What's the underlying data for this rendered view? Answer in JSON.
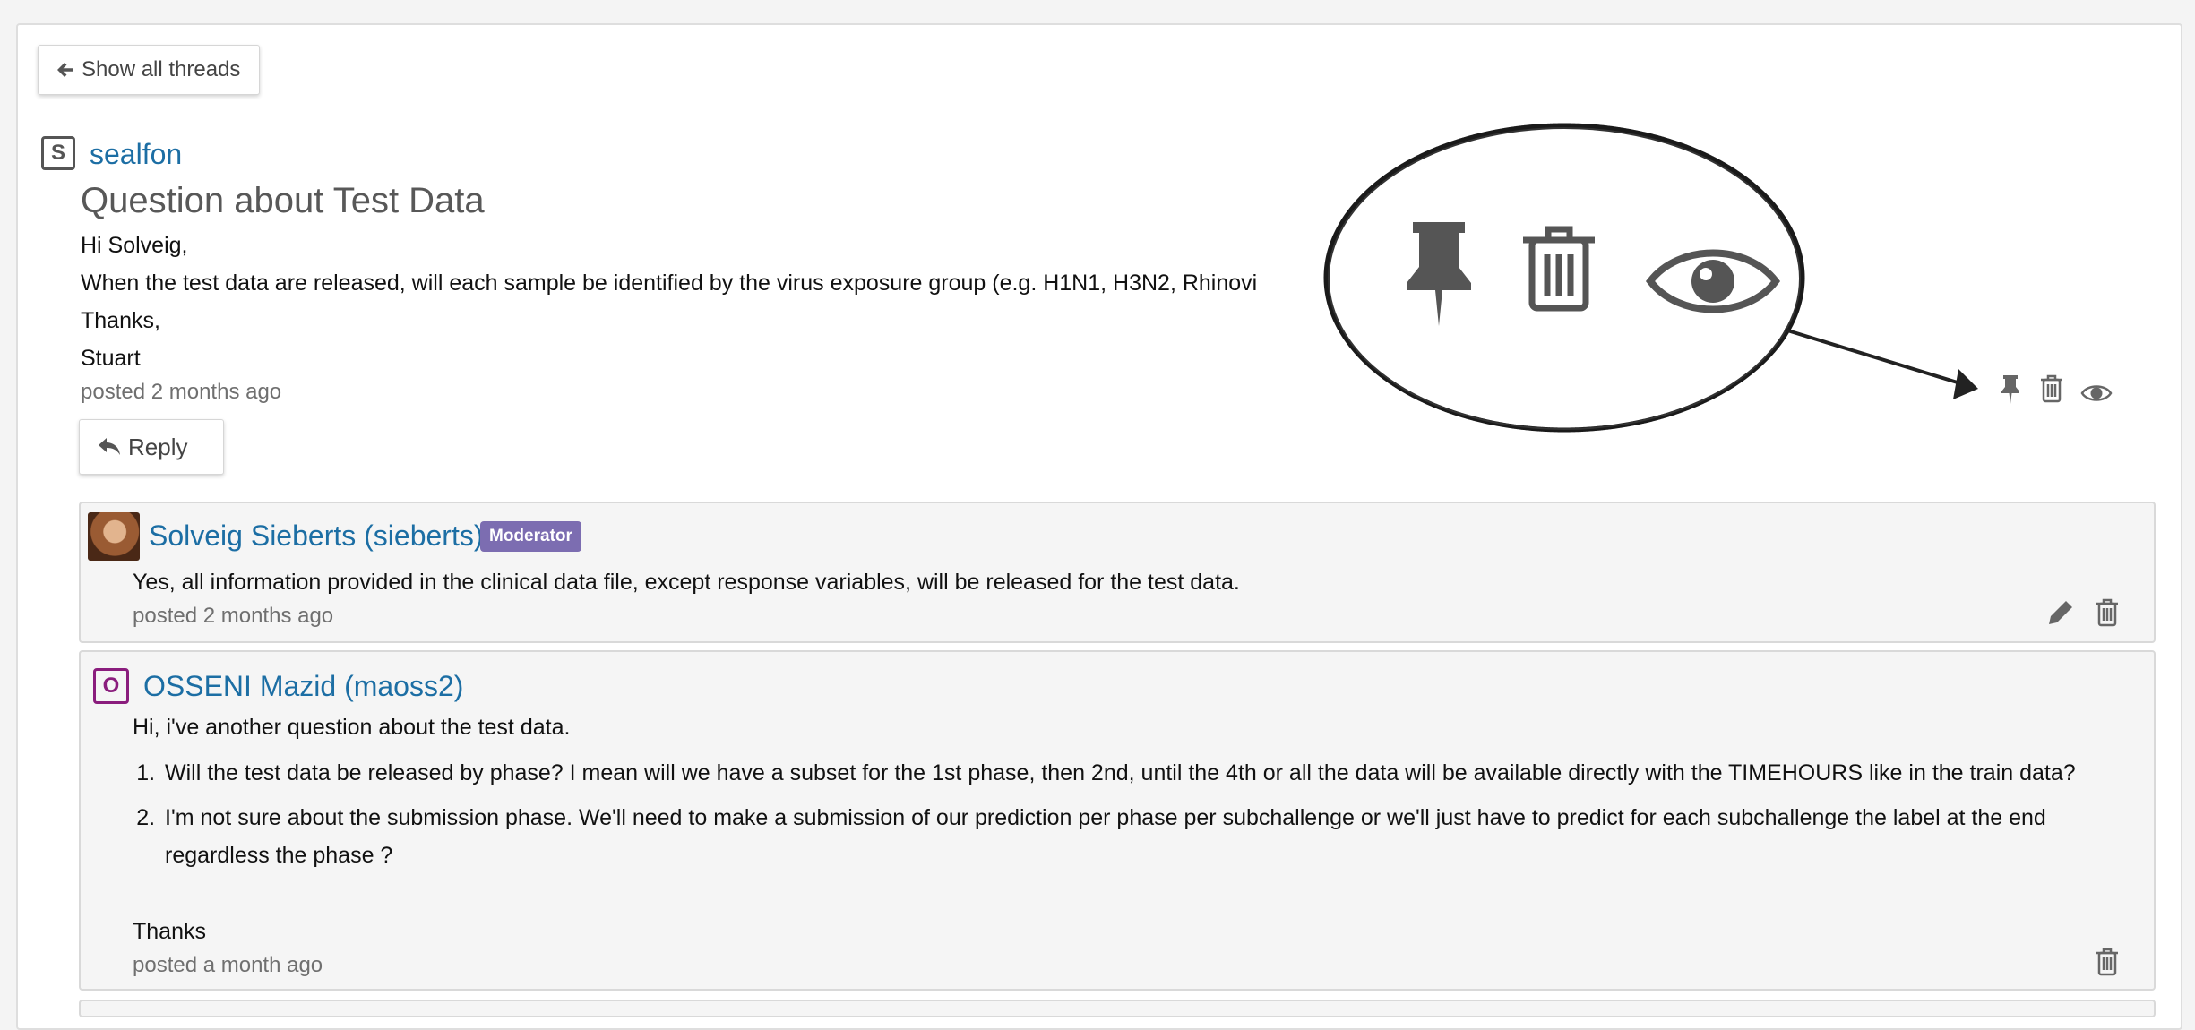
{
  "nav": {
    "back_label": "Show all threads"
  },
  "thread": {
    "author_initial": "S",
    "author": "sealfon",
    "title": "Question about Test Data",
    "body": [
      "Hi Solveig,",
      "When the test data are released, will each sample be identified by the virus exposure group (e.g. H1N1, H3N2, Rhinovi",
      "Thanks,",
      "Stuart"
    ],
    "posted": "posted 2 months ago",
    "reply_label": "Reply",
    "actions": [
      "pin-icon",
      "trash-icon",
      "eye-icon"
    ]
  },
  "replies": [
    {
      "author": "Solveig Sieberts (sieberts)",
      "badge": "Moderator",
      "body": "Yes, all information provided in the clinical data file, except response variables, will be released for the test data.",
      "posted": "posted 2 months ago",
      "actions": [
        "pencil-icon",
        "trash-icon"
      ]
    },
    {
      "author_initial": "O",
      "author": "OSSENI Mazid (maoss2)",
      "intro": "Hi, i've another question about the test data.",
      "items": [
        "Will the test data be released by phase? I mean will we have a subset for the 1st phase, then 2nd, until the 4th or all the data will be available directly with the TIMEHOURS like in the train data?",
        "I'm not sure about the submission phase. We'll need to make a submission of our prediction per phase per subchallenge or we'll just have to predict for each subchallenge the label at the end regardless the phase ?"
      ],
      "closing": "Thanks",
      "posted": "posted a month ago",
      "actions": [
        "trash-icon"
      ]
    }
  ],
  "colors": {
    "link": "#1c6ea4",
    "moderator_badge": "#7c6db1",
    "thread_avatar": "#555555",
    "reply_avatar": "#8a1d7d"
  }
}
